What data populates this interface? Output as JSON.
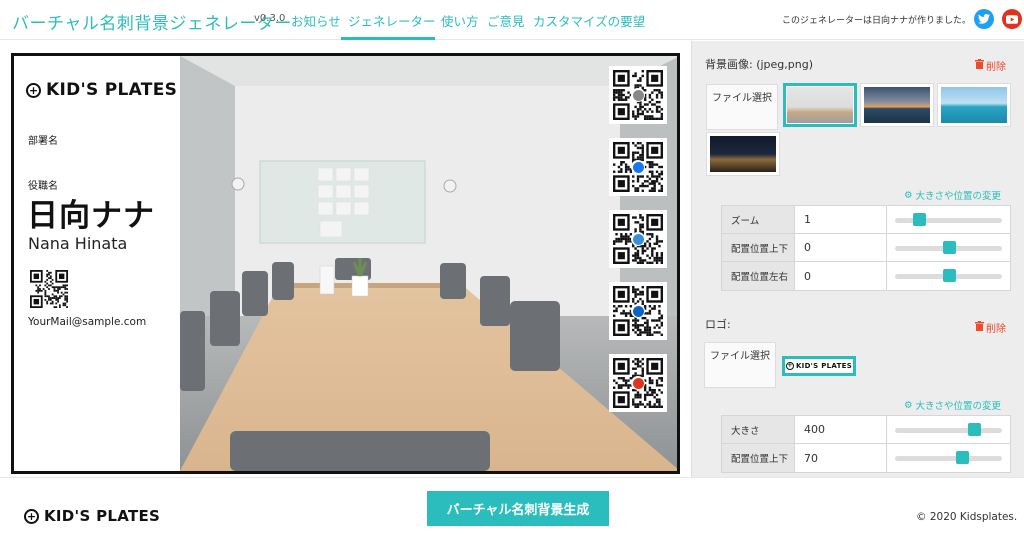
{
  "header": {
    "title": "バーチャル名刺背景ジェネレーター",
    "version": "v0.3.0",
    "nav": [
      {
        "label": "お知らせ",
        "active": false
      },
      {
        "label": "ジェネレーター",
        "active": true
      },
      {
        "label": "使い方",
        "active": false
      },
      {
        "label": "ご意見",
        "active": false
      },
      {
        "label": "カスタマイズの要望",
        "active": false
      }
    ],
    "credit": "このジェネレーターは日向ナナが作りました。",
    "social": [
      {
        "icon": "twitter-icon",
        "color": "#1da1f2"
      },
      {
        "icon": "youtube-icon",
        "color": "#e0331d"
      }
    ]
  },
  "card": {
    "logo_text": "KID'S PLATES",
    "department": "部署名",
    "role": "役職名",
    "name": "日向ナナ",
    "name_roman": "Nana Hinata",
    "email": "YourMail@sample.com",
    "qr_badges": [
      {
        "icon": "link-icon",
        "color": "#888888"
      },
      {
        "icon": "facebook-icon",
        "color": "#1877f2"
      },
      {
        "icon": "infinity-icon",
        "color": "#3b8fd4"
      },
      {
        "icon": "linkedin-icon",
        "color": "#0a66c2"
      },
      {
        "icon": "youtube-icon",
        "color": "#e0331d"
      }
    ]
  },
  "background_section": {
    "label": "背景画像: (jpeg,png)",
    "delete_label": "削除",
    "file_button": "ファイル選択",
    "adjust_link": "大きさや位置の変更",
    "thumbnails": [
      {
        "name": "meeting-room",
        "selected": true
      },
      {
        "name": "sunset-sea",
        "selected": false
      },
      {
        "name": "blue-sea",
        "selected": false
      },
      {
        "name": "night-building",
        "selected": false
      }
    ],
    "controls": [
      {
        "label": "ズーム",
        "value": "1",
        "slider": 0.22
      },
      {
        "label": "配置位置上下",
        "value": "0",
        "slider": 0.5
      },
      {
        "label": "配置位置左右",
        "value": "0",
        "slider": 0.5
      }
    ]
  },
  "logo_section": {
    "label": "ロゴ:",
    "delete_label": "削除",
    "file_button": "ファイル選択",
    "logo_thumb_text": "KID'S PLATES",
    "adjust_link": "大きさや位置の変更",
    "controls": [
      {
        "label": "大きさ",
        "value": "400",
        "slider": 0.74
      },
      {
        "label": "配置位置上下",
        "value": "70",
        "slider": 0.63
      }
    ]
  },
  "footer": {
    "logo_text": "KID'S PLATES",
    "generate_button": "バーチャル名刺背景生成",
    "copyright": "© 2020 Kidsplates."
  },
  "colors": {
    "accent": "#2bbdbd",
    "delete": "#ee4a2c",
    "panel_bg": "#ededed"
  }
}
